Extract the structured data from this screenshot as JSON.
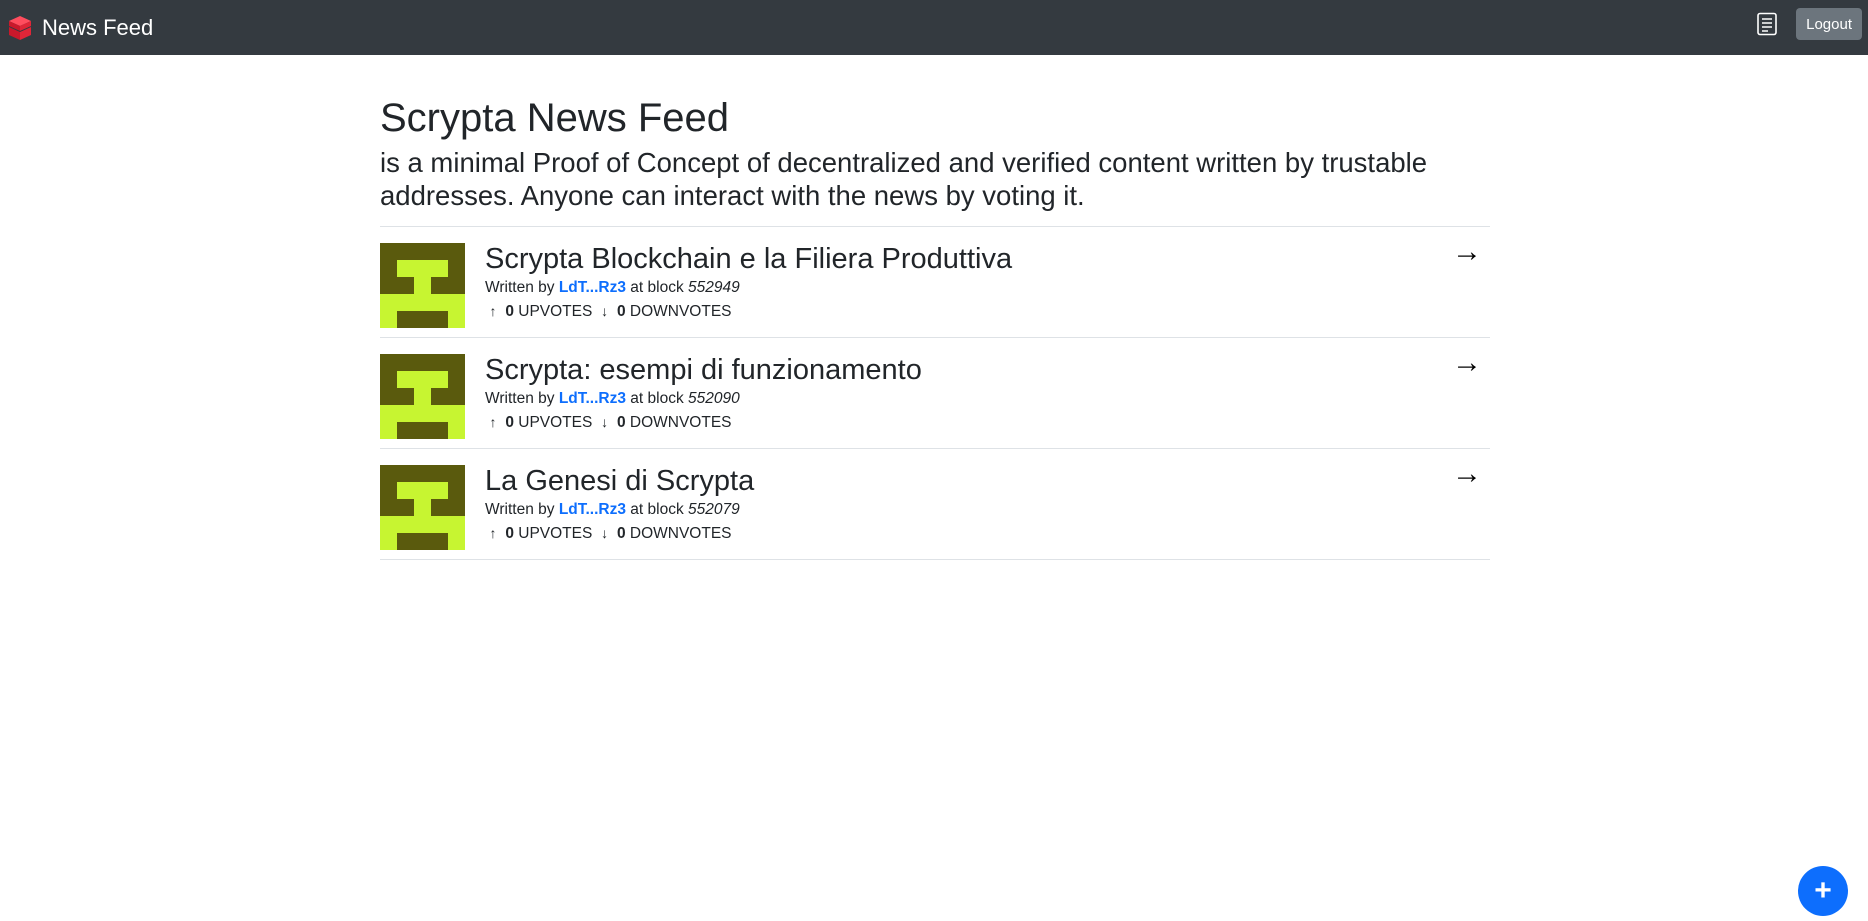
{
  "app": {
    "brand": "News Feed"
  },
  "header": {
    "logout_label": "Logout",
    "doc_icon": "document-icon",
    "brand_icon": "cube-stack-icon"
  },
  "main": {
    "title": "Scrypta News Feed",
    "description": "is a minimal Proof of Concept of decentralized and verified content written by trustable addresses. Anyone can interact with the news by voting it."
  },
  "labels": {
    "written_by": "Written by",
    "at_block": "at block",
    "upvotes": "UPVOTES",
    "downvotes": "DOWNVOTES",
    "up_arrow": "↑",
    "down_arrow": "↓",
    "open_arrow": "→"
  },
  "news": [
    {
      "title": "Scrypta Blockchain e la Filiera Produttiva",
      "author": "LdT...Rz3",
      "block": "552949",
      "upvotes": "0",
      "downvotes": "0"
    },
    {
      "title": "Scrypta: esempi di funzionamento",
      "author": "LdT...Rz3",
      "block": "552090",
      "upvotes": "0",
      "downvotes": "0"
    },
    {
      "title": "La Genesi di Scrypta",
      "author": "LdT...Rz3",
      "block": "552079",
      "upvotes": "0",
      "downvotes": "0"
    }
  ],
  "fab": {
    "label": "+"
  },
  "colors": {
    "navbar": "#343a40",
    "accent": "#0d6efd",
    "avatar_bg": "#5a5a0d",
    "avatar_fg": "#c7f531"
  }
}
